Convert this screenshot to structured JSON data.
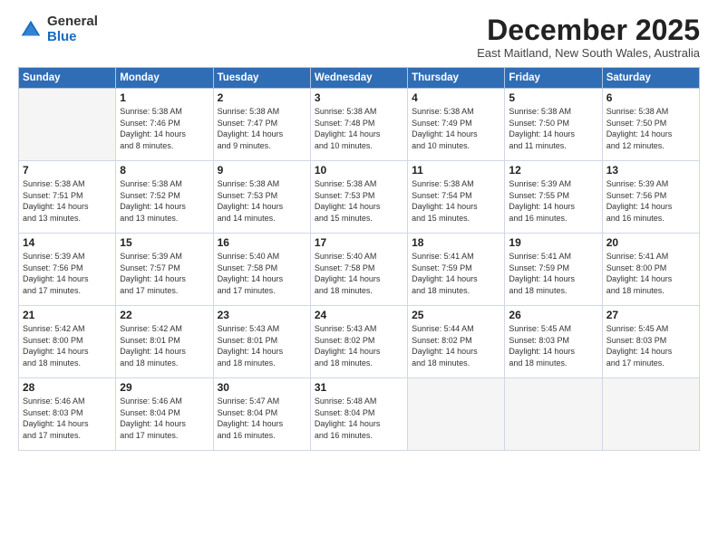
{
  "logo": {
    "general": "General",
    "blue": "Blue"
  },
  "header": {
    "month": "December 2025",
    "location": "East Maitland, New South Wales, Australia"
  },
  "weekdays": [
    "Sunday",
    "Monday",
    "Tuesday",
    "Wednesday",
    "Thursday",
    "Friday",
    "Saturday"
  ],
  "weeks": [
    [
      {
        "day": "",
        "info": ""
      },
      {
        "day": "1",
        "info": "Sunrise: 5:38 AM\nSunset: 7:46 PM\nDaylight: 14 hours\nand 8 minutes."
      },
      {
        "day": "2",
        "info": "Sunrise: 5:38 AM\nSunset: 7:47 PM\nDaylight: 14 hours\nand 9 minutes."
      },
      {
        "day": "3",
        "info": "Sunrise: 5:38 AM\nSunset: 7:48 PM\nDaylight: 14 hours\nand 10 minutes."
      },
      {
        "day": "4",
        "info": "Sunrise: 5:38 AM\nSunset: 7:49 PM\nDaylight: 14 hours\nand 10 minutes."
      },
      {
        "day": "5",
        "info": "Sunrise: 5:38 AM\nSunset: 7:50 PM\nDaylight: 14 hours\nand 11 minutes."
      },
      {
        "day": "6",
        "info": "Sunrise: 5:38 AM\nSunset: 7:50 PM\nDaylight: 14 hours\nand 12 minutes."
      }
    ],
    [
      {
        "day": "7",
        "info": "Sunrise: 5:38 AM\nSunset: 7:51 PM\nDaylight: 14 hours\nand 13 minutes."
      },
      {
        "day": "8",
        "info": "Sunrise: 5:38 AM\nSunset: 7:52 PM\nDaylight: 14 hours\nand 13 minutes."
      },
      {
        "day": "9",
        "info": "Sunrise: 5:38 AM\nSunset: 7:53 PM\nDaylight: 14 hours\nand 14 minutes."
      },
      {
        "day": "10",
        "info": "Sunrise: 5:38 AM\nSunset: 7:53 PM\nDaylight: 14 hours\nand 15 minutes."
      },
      {
        "day": "11",
        "info": "Sunrise: 5:38 AM\nSunset: 7:54 PM\nDaylight: 14 hours\nand 15 minutes."
      },
      {
        "day": "12",
        "info": "Sunrise: 5:39 AM\nSunset: 7:55 PM\nDaylight: 14 hours\nand 16 minutes."
      },
      {
        "day": "13",
        "info": "Sunrise: 5:39 AM\nSunset: 7:56 PM\nDaylight: 14 hours\nand 16 minutes."
      }
    ],
    [
      {
        "day": "14",
        "info": "Sunrise: 5:39 AM\nSunset: 7:56 PM\nDaylight: 14 hours\nand 17 minutes."
      },
      {
        "day": "15",
        "info": "Sunrise: 5:39 AM\nSunset: 7:57 PM\nDaylight: 14 hours\nand 17 minutes."
      },
      {
        "day": "16",
        "info": "Sunrise: 5:40 AM\nSunset: 7:58 PM\nDaylight: 14 hours\nand 17 minutes."
      },
      {
        "day": "17",
        "info": "Sunrise: 5:40 AM\nSunset: 7:58 PM\nDaylight: 14 hours\nand 18 minutes."
      },
      {
        "day": "18",
        "info": "Sunrise: 5:41 AM\nSunset: 7:59 PM\nDaylight: 14 hours\nand 18 minutes."
      },
      {
        "day": "19",
        "info": "Sunrise: 5:41 AM\nSunset: 7:59 PM\nDaylight: 14 hours\nand 18 minutes."
      },
      {
        "day": "20",
        "info": "Sunrise: 5:41 AM\nSunset: 8:00 PM\nDaylight: 14 hours\nand 18 minutes."
      }
    ],
    [
      {
        "day": "21",
        "info": "Sunrise: 5:42 AM\nSunset: 8:00 PM\nDaylight: 14 hours\nand 18 minutes."
      },
      {
        "day": "22",
        "info": "Sunrise: 5:42 AM\nSunset: 8:01 PM\nDaylight: 14 hours\nand 18 minutes."
      },
      {
        "day": "23",
        "info": "Sunrise: 5:43 AM\nSunset: 8:01 PM\nDaylight: 14 hours\nand 18 minutes."
      },
      {
        "day": "24",
        "info": "Sunrise: 5:43 AM\nSunset: 8:02 PM\nDaylight: 14 hours\nand 18 minutes."
      },
      {
        "day": "25",
        "info": "Sunrise: 5:44 AM\nSunset: 8:02 PM\nDaylight: 14 hours\nand 18 minutes."
      },
      {
        "day": "26",
        "info": "Sunrise: 5:45 AM\nSunset: 8:03 PM\nDaylight: 14 hours\nand 18 minutes."
      },
      {
        "day": "27",
        "info": "Sunrise: 5:45 AM\nSunset: 8:03 PM\nDaylight: 14 hours\nand 17 minutes."
      }
    ],
    [
      {
        "day": "28",
        "info": "Sunrise: 5:46 AM\nSunset: 8:03 PM\nDaylight: 14 hours\nand 17 minutes."
      },
      {
        "day": "29",
        "info": "Sunrise: 5:46 AM\nSunset: 8:04 PM\nDaylight: 14 hours\nand 17 minutes."
      },
      {
        "day": "30",
        "info": "Sunrise: 5:47 AM\nSunset: 8:04 PM\nDaylight: 14 hours\nand 16 minutes."
      },
      {
        "day": "31",
        "info": "Sunrise: 5:48 AM\nSunset: 8:04 PM\nDaylight: 14 hours\nand 16 minutes."
      },
      {
        "day": "",
        "info": ""
      },
      {
        "day": "",
        "info": ""
      },
      {
        "day": "",
        "info": ""
      }
    ]
  ]
}
